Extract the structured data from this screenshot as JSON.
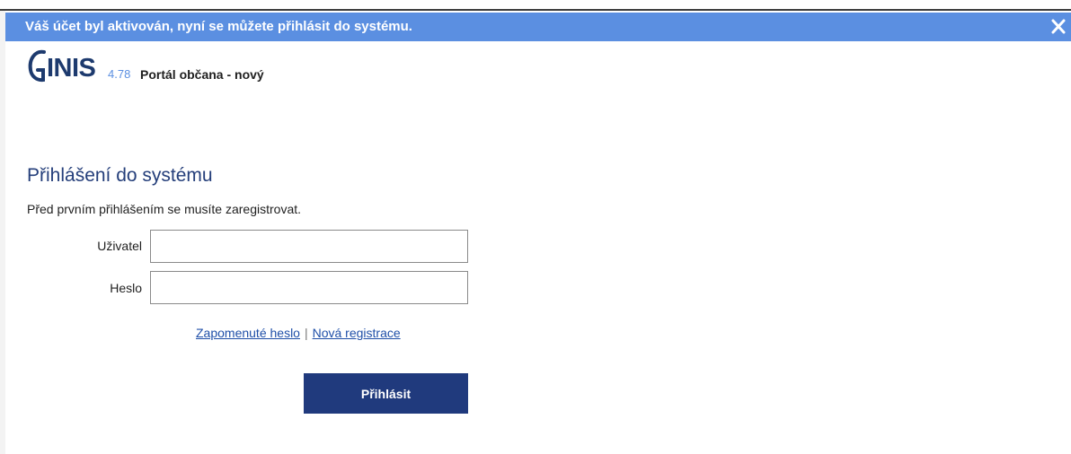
{
  "notification": {
    "message": "Váš účet byl aktivován, nyní se můžete přihlásit do systému.",
    "close_icon": "close-icon"
  },
  "header": {
    "brand": "INIS",
    "version": "4.78",
    "product": "Portál občana - nový"
  },
  "login": {
    "title": "Přihlášení do systému",
    "note": "Před prvním přihlášením se musíte zaregistrovat.",
    "user_label": "Uživatel",
    "user_value": "",
    "password_label": "Heslo",
    "password_value": "",
    "forgot_link": "Zapomenuté heslo",
    "separator": "|",
    "register_link": "Nová registrace",
    "submit_label": "Přihlásit"
  },
  "colors": {
    "notification_bg": "#5b8fe1",
    "brand": "#1d3a6e",
    "accent": "#5b8fe1",
    "button": "#203a7d",
    "link": "#1f4fa8"
  }
}
